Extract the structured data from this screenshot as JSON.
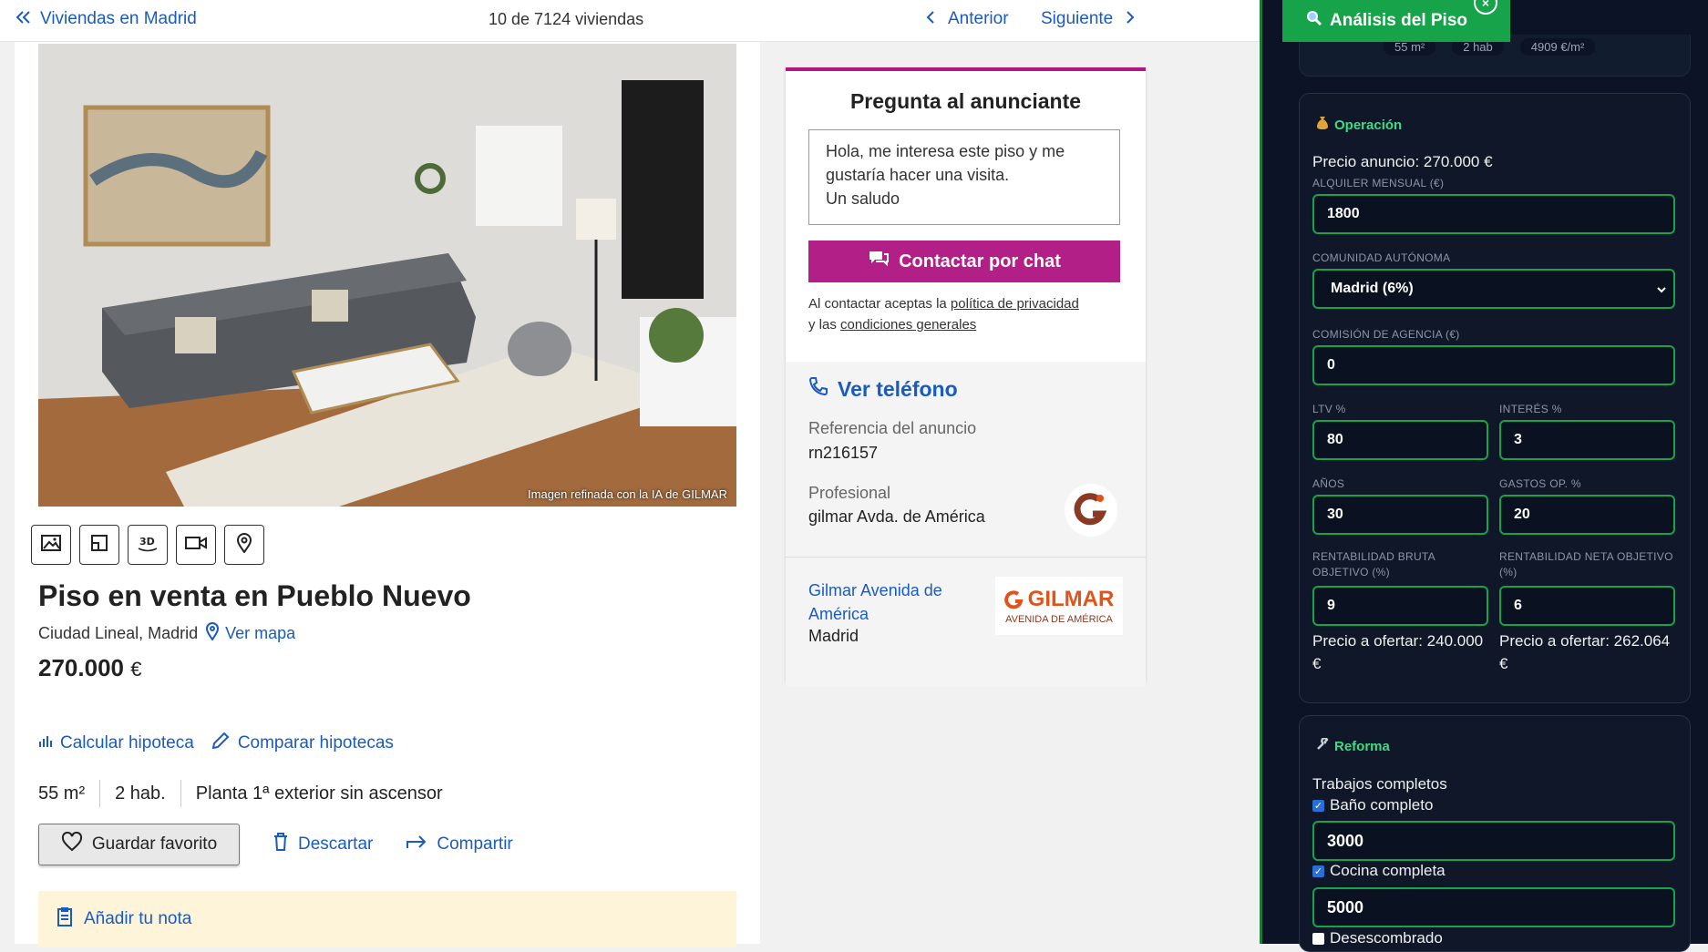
{
  "topbar": {
    "back_label": "Viviendas en Madrid",
    "count": "10 de 7124 viviendas",
    "prev_label": "Anterior",
    "next_label": "Siguiente"
  },
  "listing": {
    "photo_caption": "Imagen refinada con la IA de GILMAR",
    "title": "Piso en venta en Pueblo Nuevo",
    "location": "Ciudad Lineal, Madrid",
    "map_label": "Ver mapa",
    "price": "270.000",
    "currency": "€",
    "mortgage_calc": "Calcular hipoteca",
    "mortgage_compare": "Comparar hipotecas",
    "features": [
      "55 m²",
      "2 hab.",
      "Planta 1ª exterior sin ascensor"
    ],
    "fav_label": "Guardar favorito",
    "discard_label": "Descartar",
    "share_label": "Compartir",
    "note_label": "Añadir tu nota"
  },
  "contact": {
    "title": "Pregunta al anunciante",
    "message_line1": "Hola, me interesa este piso y me",
    "message_line2": "gustaría hacer una visita.",
    "message_line3": "Un saludo",
    "chat_label": "Contactar por chat",
    "legal_pre": "Al contactar aceptas la ",
    "legal_privacy": "política de privacidad",
    "legal_mid": "y las ",
    "legal_terms": "condiciones generales",
    "phone_label": "Ver teléfono",
    "ref_label": "Referencia del anuncio",
    "ref_value": "rn216157",
    "pro_label": "Profesional",
    "pro_value": "gilmar Avda. de América",
    "agency_name": "Gilmar Avenida de América",
    "agency_city": "Madrid",
    "agency_logo_main": "GILMAR",
    "agency_logo_sub": "AVENIDA DE AMÉRICA"
  },
  "panel": {
    "title": "Análisis del Piso",
    "close_glyph": "×",
    "summary_chips": [
      "55 m²",
      "2 hab",
      "4909 €/m²"
    ],
    "operation": {
      "section": "Operación",
      "ad_price": "Precio anuncio: 270.000 €",
      "rent_label": "ALQUILER MENSUAL (€)",
      "rent_value": "1800",
      "region_label": "COMUNIDAD AUTÓNOMA",
      "region_value": "Madrid (6%)",
      "commission_label": "COMISIÓN DE AGENCIA (€)",
      "commission_value": "0",
      "ltv_label": "LTV %",
      "ltv_value": "80",
      "interest_label": "INTERÉS %",
      "interest_value": "3",
      "years_label": "AÑOS",
      "years_value": "30",
      "opex_label": "GASTOS OP. %",
      "opex_value": "20",
      "gross_label": "RENTABILIDAD BRUTA OBJETIVO (%)",
      "gross_value": "9",
      "net_label": "RENTABILIDAD NETA OBJETIVO (%)",
      "net_value": "6",
      "gross_offer": "Precio a ofertar: 240.000 €",
      "net_offer": "Precio a ofertar: 262.064 €"
    },
    "reform": {
      "section": "Reforma",
      "subtitle": "Trabajos completos",
      "bath_label": "Baño completo",
      "bath_checked": true,
      "bath_value": "3000",
      "kitchen_label": "Cocina completa",
      "kitchen_checked": true,
      "kitchen_value": "5000",
      "debris_label": "Desescombrado",
      "debris_checked": false
    }
  }
}
